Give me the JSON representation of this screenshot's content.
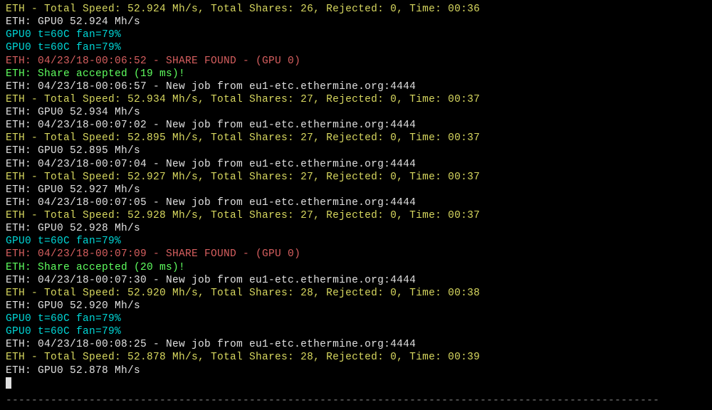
{
  "lines": {
    "l0": "ETH - Total Speed: 52.924 Mh/s, Total Shares: 26, Rejected: 0, Time: 00:36",
    "l1": "ETH: GPU0 52.924 Mh/s",
    "l2": "GPU0 t=60C fan=79%",
    "l3": "GPU0 t=60C fan=79%",
    "l4": "ETH: 04/23/18-00:06:52 - SHARE FOUND - (GPU 0)",
    "l5": "ETH: Share accepted (19 ms)!",
    "l6": "ETH: 04/23/18-00:06:57 - New job from eu1-etc.ethermine.org:4444",
    "l7": "ETH - Total Speed: 52.934 Mh/s, Total Shares: 27, Rejected: 0, Time: 00:37",
    "l8": "ETH: GPU0 52.934 Mh/s",
    "l9": "ETH: 04/23/18-00:07:02 - New job from eu1-etc.ethermine.org:4444",
    "l10": "ETH - Total Speed: 52.895 Mh/s, Total Shares: 27, Rejected: 0, Time: 00:37",
    "l11": "ETH: GPU0 52.895 Mh/s",
    "l12": "ETH: 04/23/18-00:07:04 - New job from eu1-etc.ethermine.org:4444",
    "l13": "ETH - Total Speed: 52.927 Mh/s, Total Shares: 27, Rejected: 0, Time: 00:37",
    "l14": "ETH: GPU0 52.927 Mh/s",
    "l15": "ETH: 04/23/18-00:07:05 - New job from eu1-etc.ethermine.org:4444",
    "l16": "ETH - Total Speed: 52.928 Mh/s, Total Shares: 27, Rejected: 0, Time: 00:37",
    "l17": "ETH: GPU0 52.928 Mh/s",
    "l18": "GPU0 t=60C fan=79%",
    "l19": "ETH: 04/23/18-00:07:09 - SHARE FOUND - (GPU 0)",
    "l20": "ETH: Share accepted (20 ms)!",
    "l21": "ETH: 04/23/18-00:07:30 - New job from eu1-etc.ethermine.org:4444",
    "l22": "ETH - Total Speed: 52.920 Mh/s, Total Shares: 28, Rejected: 0, Time: 00:38",
    "l23": "ETH: GPU0 52.920 Mh/s",
    "l24": "GPU0 t=60C fan=79%",
    "l25": "GPU0 t=60C fan=79%",
    "l26": "ETH: 04/23/18-00:08:25 - New job from eu1-etc.ethermine.org:4444",
    "l27": "ETH - Total Speed: 52.878 Mh/s, Total Shares: 28, Rejected: 0, Time: 00:39",
    "l28": "ETH: GPU0 52.878 Mh/s",
    "l29": "------------------------------------------------------------------------------------------------------"
  }
}
